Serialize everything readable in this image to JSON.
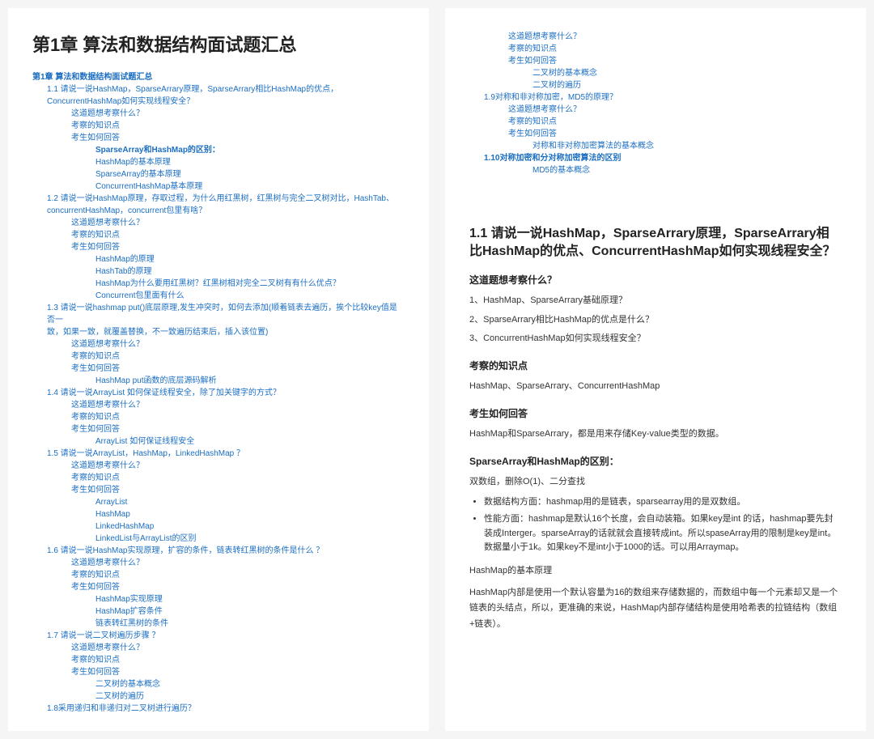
{
  "pageTitle": "第1章 算法和数据结构面试题汇总",
  "tocLeft": [
    {
      "lvl": 0,
      "bold": true,
      "text": "第1章 算法和数据结构面试题汇总"
    },
    {
      "lvl": 1,
      "text": "1.1  请说一说HashMap，SparseArrary原理，SparseArrary相比HashMap的优点，"
    },
    {
      "lvl": 1,
      "text": "ConcurrentHashMap如何实现线程安全？"
    },
    {
      "lvl": 2,
      "text": "这道题想考察什么？"
    },
    {
      "lvl": 2,
      "text": "考察的知识点"
    },
    {
      "lvl": 2,
      "text": "考生如何回答"
    },
    {
      "lvl": 3,
      "bold": true,
      "text": "SparseArray和HashMap的区别："
    },
    {
      "lvl": 3,
      "text": "HashMap的基本原理"
    },
    {
      "lvl": 3,
      "text": "SparseArray的基本原理"
    },
    {
      "lvl": 3,
      "text": "ConcurrentHashMap基本原理"
    },
    {
      "lvl": 1,
      "text": "1.2  请说一说HashMap原理，存取过程，为什么用红黑树，红黑树与完全二叉树对比，HashTab、"
    },
    {
      "lvl": 1,
      "text": "concurrentHashMap，concurrent包里有啥？"
    },
    {
      "lvl": 2,
      "text": "这道题想考察什么？"
    },
    {
      "lvl": 2,
      "text": "考察的知识点"
    },
    {
      "lvl": 2,
      "text": "考生如何回答"
    },
    {
      "lvl": 3,
      "text": "HashMap的原理"
    },
    {
      "lvl": 3,
      "text": "HashTab的原理"
    },
    {
      "lvl": 3,
      "text": "HashMap为什么要用红黑树？红黑树相对完全二叉树有有什么优点？"
    },
    {
      "lvl": 3,
      "text": "Concurrent包里面有什么"
    },
    {
      "lvl": 1,
      "text": "1.3  请说一说hashmap put()底层原理,发生冲突时，如何去添加(顺着链表去遍历，挨个比较key值是否一"
    },
    {
      "lvl": 1,
      "text": "致，如果一致，就覆盖替换，不一致遍历结束后，插入该位置)"
    },
    {
      "lvl": 2,
      "text": "这道题想考察什么？"
    },
    {
      "lvl": 2,
      "text": "考察的知识点"
    },
    {
      "lvl": 2,
      "text": "考生如何回答"
    },
    {
      "lvl": 3,
      "text": "HashMap put函数的底层源码解析"
    },
    {
      "lvl": 1,
      "text": "1.4  请说一说ArrayList 如何保证线程安全，除了加关键字的方式？"
    },
    {
      "lvl": 2,
      "text": "这道题想考察什么？"
    },
    {
      "lvl": 2,
      "text": "考察的知识点"
    },
    {
      "lvl": 2,
      "text": "考生如何回答"
    },
    {
      "lvl": 3,
      "text": "ArrayList 如何保证线程安全"
    },
    {
      "lvl": 1,
      "text": "1.5  请说一说ArrayList，HashMap，LinkedHashMap ？"
    },
    {
      "lvl": 2,
      "text": "这道题想考察什么？"
    },
    {
      "lvl": 2,
      "text": "考察的知识点"
    },
    {
      "lvl": 2,
      "text": "考生如何回答"
    },
    {
      "lvl": 3,
      "text": "ArrayList"
    },
    {
      "lvl": 3,
      "text": "HashMap"
    },
    {
      "lvl": 3,
      "text": "LinkedHashMap"
    },
    {
      "lvl": 3,
      "text": "LinkedList与ArrayList的区别"
    },
    {
      "lvl": 1,
      "text": "1.6  请说一说HashMap实现原理，扩容的条件，链表转红黑树的条件是什么 ？"
    },
    {
      "lvl": 2,
      "text": "这道题想考察什么？"
    },
    {
      "lvl": 2,
      "text": "考察的知识点"
    },
    {
      "lvl": 2,
      "text": "考生如何回答"
    },
    {
      "lvl": 3,
      "text": "HashMap实现原理"
    },
    {
      "lvl": 3,
      "text": "HashMap扩容条件"
    },
    {
      "lvl": 3,
      "text": "链表转红黑树的条件"
    },
    {
      "lvl": 1,
      "text": "1.7  请说一说二叉树遍历步骤 ？"
    },
    {
      "lvl": 2,
      "text": "这道题想考察什么？"
    },
    {
      "lvl": 2,
      "text": "考察的知识点"
    },
    {
      "lvl": 2,
      "text": "考生如何回答"
    },
    {
      "lvl": 3,
      "text": "二叉树的基本概念"
    },
    {
      "lvl": 3,
      "text": "二叉树的遍历"
    },
    {
      "lvl": 1,
      "text": "1.8采用递归和非递归对二叉树进行遍历？"
    }
  ],
  "tocRight": [
    {
      "lvl": 2,
      "text": "这道题想考察什么？"
    },
    {
      "lvl": 2,
      "text": "考察的知识点"
    },
    {
      "lvl": 2,
      "text": "考生如何回答"
    },
    {
      "lvl": 3,
      "text": "二叉树的基本概念"
    },
    {
      "lvl": 3,
      "text": "二叉树的遍历"
    },
    {
      "lvl": 1,
      "text": "1.9对称和非对称加密，MD5的原理？"
    },
    {
      "lvl": 2,
      "text": "这道题想考察什么？"
    },
    {
      "lvl": 2,
      "text": "考察的知识点"
    },
    {
      "lvl": 2,
      "text": "考生如何回答"
    },
    {
      "lvl": 3,
      "text": "对称和非对称加密算法的基本概念"
    },
    {
      "lvl": 1,
      "bold": true,
      "text": "1.10对称加密和分对称加密算法的区别"
    },
    {
      "lvl": 3,
      "text": "MD5的基本概念"
    }
  ],
  "section": {
    "title": "1.1 请说一说HashMap，SparseArrary原理，SparseArrary相比HashMap的优点、ConcurrentHashMap如何实现线程安全？",
    "h1": "这道题想考察什么？",
    "q1": "1、HashMap、SparseArrary基础原理？",
    "q2": "2、SparseArrary相比HashMap的优点是什么？",
    "q3": "3、ConcurrentHashMap如何实现线程安全？",
    "h2": "考察的知识点",
    "p2": "HashMap、SparseArrary、ConcurrentHashMap",
    "h3": "考生如何回答",
    "p3": "HashMap和SparseArrary，都是用来存储Key-value类型的数据。",
    "h4": "SparseArray和HashMap的区别：",
    "p4": "双数组，删除O(1)、二分查找",
    "b1": "数据结构方面：hashmap用的是链表，sparsearray用的是双数组。",
    "b2": "性能方面：hashmap是默认16个长度，会自动装箱。如果key是int 的话，hashmap要先封装成Interger。sparseArray的话就就会直接转成int。所以spaseArray用的限制是key是int。数据量小于1k。如果key不是int小于1000的话。可以用Arraymap。",
    "h5": "HashMap的基本原理",
    "p5": "HashMap内部是使用一个默认容量为16的数组来存储数据的，而数组中每一个元素却又是一个链表的头结点，所以，更准确的来说，HashMap内部存储结构是使用哈希表的拉链结构（数组+链表）。"
  }
}
